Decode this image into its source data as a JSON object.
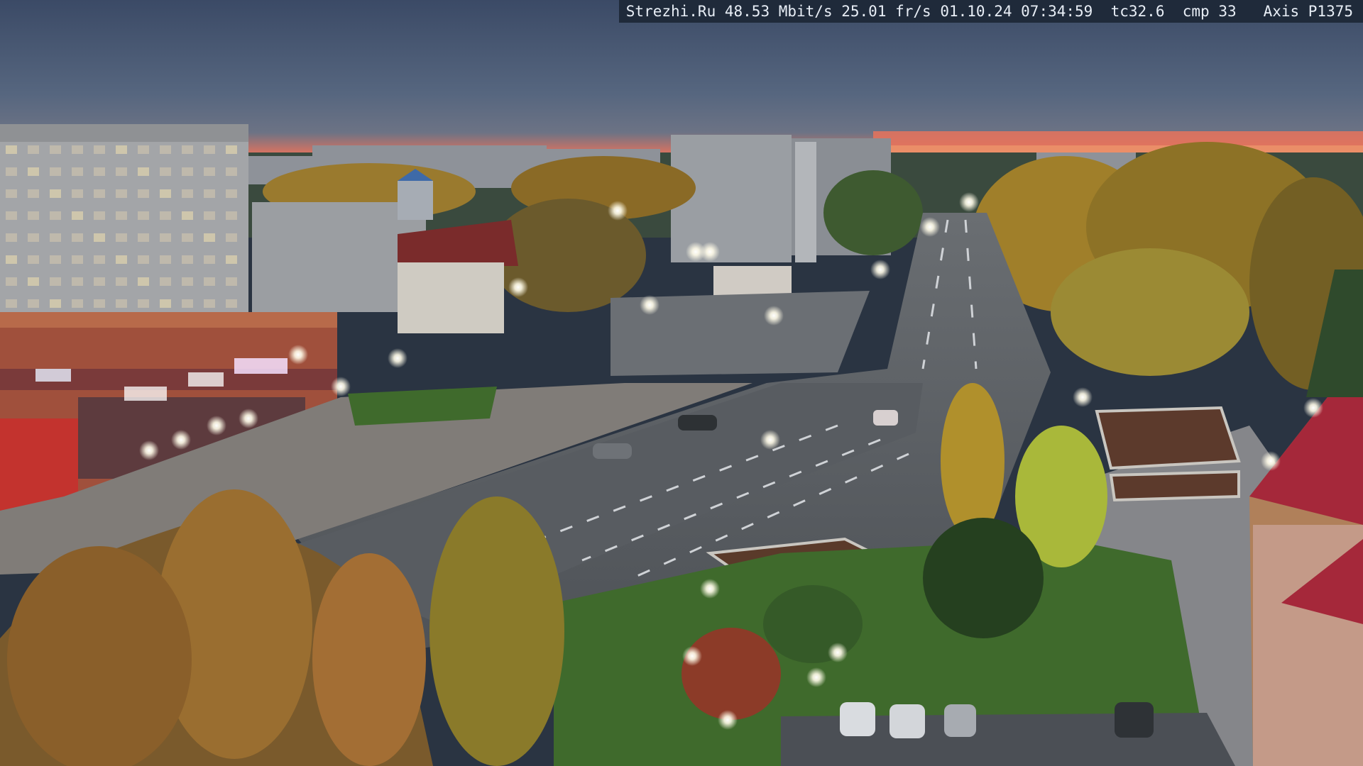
{
  "camera_overlay": {
    "site": "Strezhi.Ru",
    "bitrate": "48.53 Mbit/s",
    "framerate": "25.01 fr/s",
    "date": "01.10.24",
    "time": "07:34:59",
    "tc": "tc32.6",
    "cmp": "cmp 33",
    "camera_model": "Axis P1375"
  },
  "signs": {
    "store_left": "",
    "store_mid": "",
    "store_right": ""
  },
  "colors": {
    "sky_top": "#3b4a66",
    "sky_mid": "#56667f",
    "horizon_glow": "#e8735c",
    "road": "#54585d",
    "grass": "#3f6a2c",
    "autumn_tree": "#b58a2a",
    "street_light": "#fffbe8"
  }
}
